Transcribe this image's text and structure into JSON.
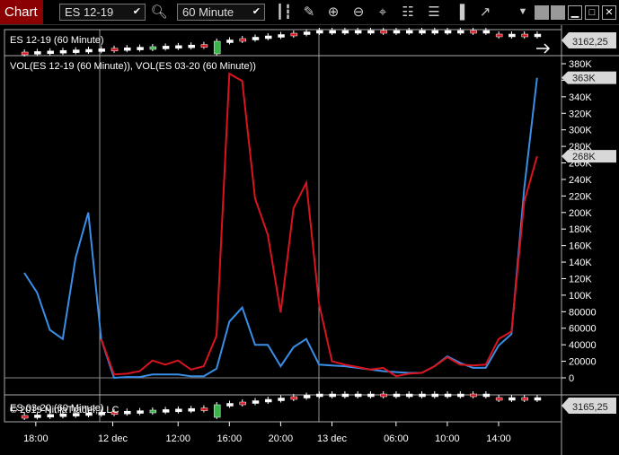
{
  "toolbar": {
    "title": "Chart",
    "instrument": "ES 12-19",
    "interval": "60 Minute",
    "icons": [
      "search-icon",
      "bars-type-icon",
      "draw-pencil-icon",
      "zoom-in-icon",
      "zoom-out-icon",
      "crosshair-icon",
      "data-box-icon",
      "properties-icon",
      "indicators-icon",
      "strategies-icon",
      "dropdown-arrow-icon",
      "minimize-icon",
      "maximize-icon",
      "close-icon"
    ]
  },
  "top_panel": {
    "label": "ES 12-19 (60 Minute)",
    "price_badge": "3162,25"
  },
  "main_panel": {
    "label": "VOL(ES 12-19 (60 Minute)), VOL(ES 03-20 (60 Minute))",
    "badges": [
      "363K",
      "268K"
    ]
  },
  "bottom_panel": {
    "label": "ES 03-20 (60 Minute)",
    "copyright": "© 2019 NinjaTrader, LLC",
    "price_badge": "3165,25"
  },
  "colors": {
    "series_blue": "#3a8ee6",
    "series_red": "#d9141e",
    "title_bg": "#8b0000",
    "badge_bg": "#d8d8d8"
  },
  "chart_data": {
    "type": "line",
    "ylim": [
      0,
      380000
    ],
    "y_ticks": [
      "0",
      "20000",
      "40000",
      "60000",
      "80000",
      "100K",
      "120K",
      "140K",
      "160K",
      "180K",
      "200K",
      "220K",
      "240K",
      "260K",
      "280K",
      "300K",
      "320K",
      "340K",
      "360K",
      "380K"
    ],
    "x_ticks": [
      {
        "label": "18:00",
        "at": 0.9
      },
      {
        "label": "12 dec",
        "at": 6.9
      },
      {
        "label": "12:00",
        "at": 12
      },
      {
        "label": "16:00",
        "at": 16
      },
      {
        "label": "20:00",
        "at": 20
      },
      {
        "label": "13 dec",
        "at": 24
      },
      {
        "label": "06:00",
        "at": 29
      },
      {
        "label": "10:00",
        "at": 33
      },
      {
        "label": "14:00",
        "at": 37
      }
    ],
    "series": [
      {
        "color": "#3a8ee6",
        "values": [
          127000,
          103000,
          58000,
          47000,
          145000,
          200000,
          47000,
          0,
          1000,
          1000,
          4000,
          4000,
          4000,
          2000,
          2000,
          11000,
          68000,
          85000,
          40000,
          40000,
          14000,
          37000,
          47000,
          16000,
          15000,
          14000,
          12000,
          10000,
          8000,
          7000,
          6000,
          6000,
          14000,
          26000,
          18000,
          12000,
          12000,
          39000,
          53000,
          229000,
          363000
        ]
      },
      {
        "color": "#d9141e",
        "values": [
          null,
          null,
          null,
          null,
          null,
          null,
          47000,
          4000,
          5000,
          8000,
          21000,
          16000,
          21000,
          10000,
          14000,
          51000,
          368000,
          359000,
          217000,
          173000,
          79000,
          205000,
          236000,
          89000,
          20000,
          16000,
          13000,
          10000,
          12000,
          2000,
          5000,
          6000,
          14000,
          25000,
          16000,
          15000,
          16000,
          47000,
          56000,
          213000,
          268000
        ]
      }
    ]
  }
}
